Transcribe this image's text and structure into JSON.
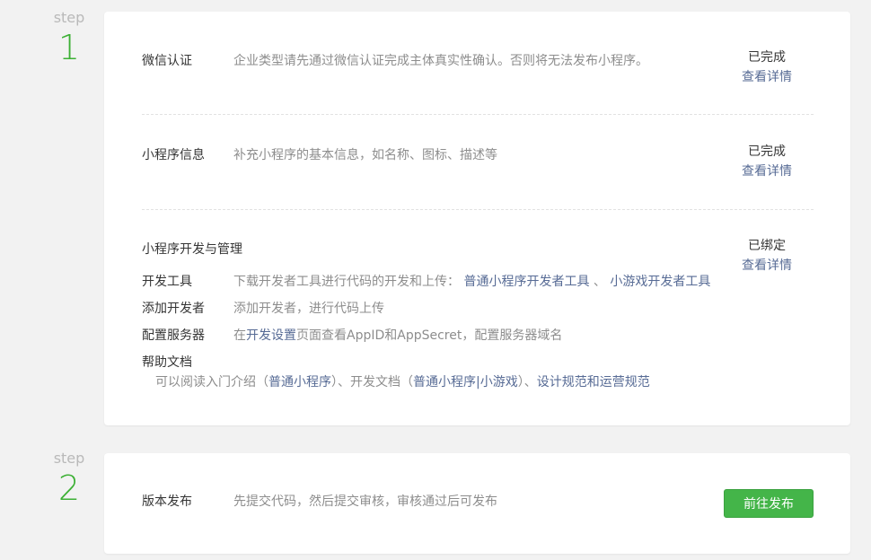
{
  "step1": {
    "step_word": "step",
    "step_num": "1",
    "wechat_auth": {
      "label": "微信认证",
      "desc": "企业类型请先通过微信认证完成主体真实性确认。否则将无法发布小程序。",
      "status": "已完成",
      "detail": "查看详情"
    },
    "mini_info": {
      "label": "小程序信息",
      "desc": "补充小程序的基本信息，如名称、图标、描述等",
      "status": "已完成",
      "detail": "查看详情"
    },
    "dev_manage": {
      "title": "小程序开发与管理",
      "status": "已绑定",
      "detail": "查看详情",
      "dev_tools": {
        "label": "开发工具",
        "desc": "下载开发者工具进行代码的开发和上传：",
        "link1": "普通小程序开发者工具",
        "sep": "、",
        "link2": "小游戏开发者工具"
      },
      "add_dev": {
        "label": "添加开发者",
        "desc": "添加开发者，进行代码上传"
      },
      "server": {
        "label": "配置服务器",
        "pre": "在",
        "link": "开发设置",
        "post": "页面查看AppID和AppSecret，配置服务器域名"
      },
      "help": {
        "label": "帮助文档",
        "t1": "可以阅读入门介绍（",
        "l1": "普通小程序",
        "t2": "）、开发文档（",
        "l2": "普通小程序",
        "t3": "|",
        "l3": "小游戏",
        "t4": "）、",
        "l4": "设计规范",
        "t5": "和",
        "l5": "运营规范"
      }
    }
  },
  "step2": {
    "step_word": "step",
    "step_num": "2",
    "release": {
      "label": "版本发布",
      "desc": "先提交代码，然后提交审核，审核通过后可发布",
      "button": "前往发布"
    }
  }
}
